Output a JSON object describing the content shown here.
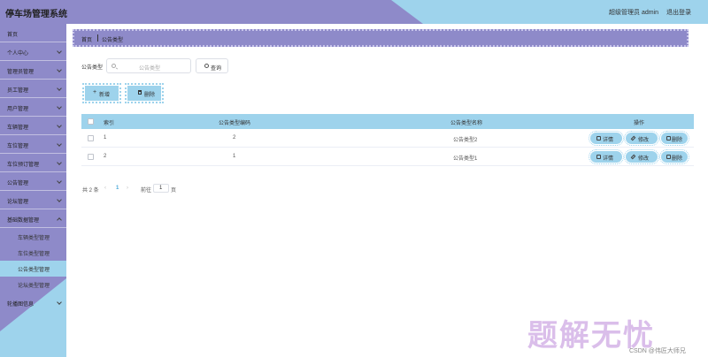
{
  "header": {
    "title": "停车场管理系统",
    "user": "超级管理员 admin",
    "logout": "退出登录"
  },
  "sidebar": {
    "items": [
      {
        "label": "首页",
        "chevron": false
      },
      {
        "label": "个人中心",
        "chevron": true
      },
      {
        "label": "管理员管理",
        "chevron": true
      },
      {
        "label": "员工管理",
        "chevron": true
      },
      {
        "label": "用户管理",
        "chevron": true
      },
      {
        "label": "车辆管理",
        "chevron": true
      },
      {
        "label": "车位管理",
        "chevron": true
      },
      {
        "label": "车位预订管理",
        "chevron": true
      },
      {
        "label": "公告管理",
        "chevron": true
      },
      {
        "label": "论坛管理",
        "chevron": true
      },
      {
        "label": "基础数据管理",
        "chevron": true
      }
    ],
    "subitems": [
      {
        "label": "车辆类型管理"
      },
      {
        "label": "车位类型管理"
      },
      {
        "label": "公告类型管理"
      },
      {
        "label": "论坛类型管理"
      }
    ],
    "last_item": {
      "label": "轮播图信息"
    }
  },
  "breadcrumb": {
    "home": "首页",
    "current": "公告类型"
  },
  "search": {
    "label": "公告类型",
    "placeholder": "公告类型",
    "query_label": "查询"
  },
  "actions": {
    "add_label": "新增",
    "delete_label": "删除"
  },
  "table": {
    "headers": [
      "索引",
      "公告类型编码",
      "公告类型名称",
      "操作"
    ],
    "rows": [
      {
        "index": "1",
        "code": "2",
        "name": "公告类型2"
      },
      {
        "index": "2",
        "code": "1",
        "name": "公告类型1"
      }
    ],
    "ops": {
      "detail": "详情",
      "edit": "修改",
      "delete": "删除"
    }
  },
  "pagination": {
    "total": "共 2 条",
    "prev": "‹",
    "page": "1",
    "next": "›",
    "goto": "前往",
    "page_value": "1",
    "page_unit": "页"
  },
  "watermark": {
    "text": "题解无忧",
    "sub": "CSDN @伟匠大师兄"
  },
  "colors": {
    "purple": "#8e8ac9",
    "blue": "#9ed3ec"
  }
}
